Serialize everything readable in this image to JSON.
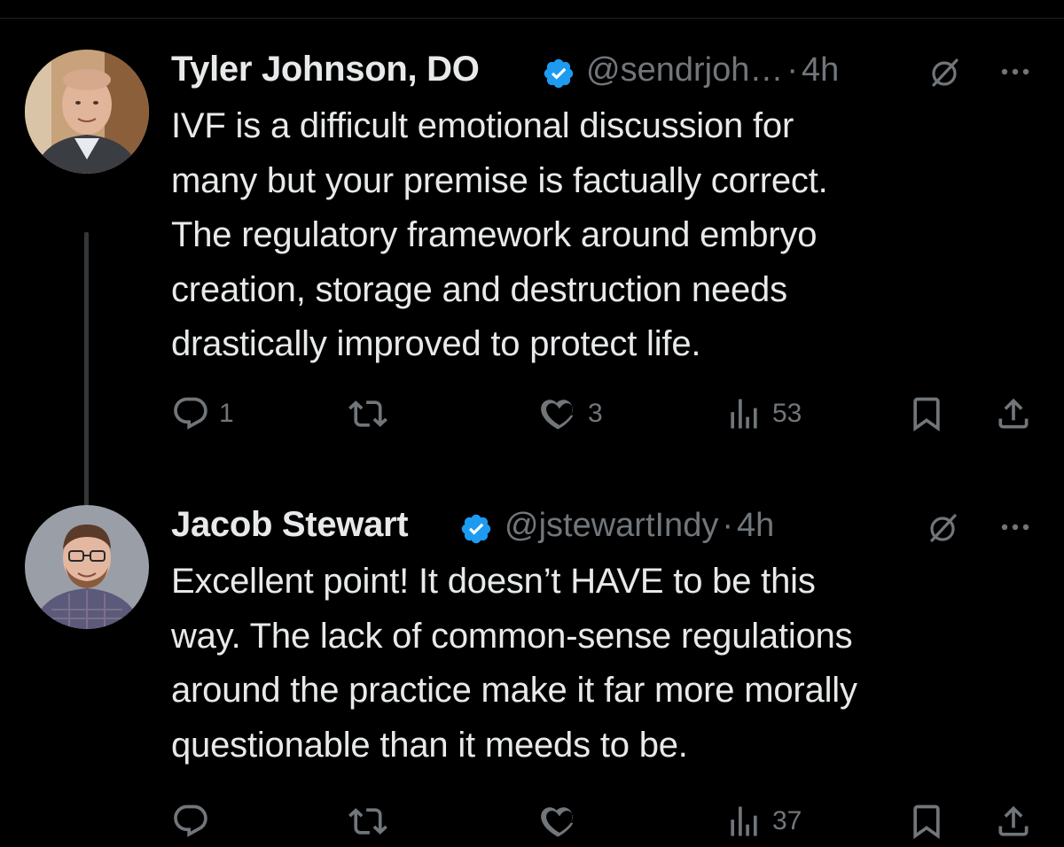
{
  "tweets": [
    {
      "author_name": "Tyler Johnson, DO",
      "handle": "@sendrjoh…",
      "separator": "·",
      "time": "4h",
      "body": "IVF is a difficult emotional discussion for\nmany but your premise is factually correct.\nThe regulatory framework around embryo\ncreation, storage and destruction needs\ndrastically improved to protect life.",
      "replies": "1",
      "reposts": "",
      "likes": "3",
      "views": "53",
      "verified": true
    },
    {
      "author_name": "Jacob Stewart",
      "handle": "@jstewartIndy",
      "separator": "·",
      "time": "4h",
      "body": "Excellent point! It doesn’t HAVE to be this\nway. The lack of common-sense regulations\naround the practice make it far more morally\nquestionable than it meeds to be.",
      "replies": "",
      "reposts": "",
      "likes": "",
      "views": "37",
      "verified": true
    }
  ],
  "colors": {
    "background": "#000000",
    "text_primary": "#e7e9ea",
    "text_secondary": "#71767b",
    "verified_blue": "#1d9bf0",
    "thread_line": "#333639"
  },
  "icons": [
    "verified-icon",
    "grok-icon",
    "more-icon",
    "reply-icon",
    "retweet-icon",
    "like-icon",
    "views-icon",
    "bookmark-icon",
    "share-icon"
  ]
}
